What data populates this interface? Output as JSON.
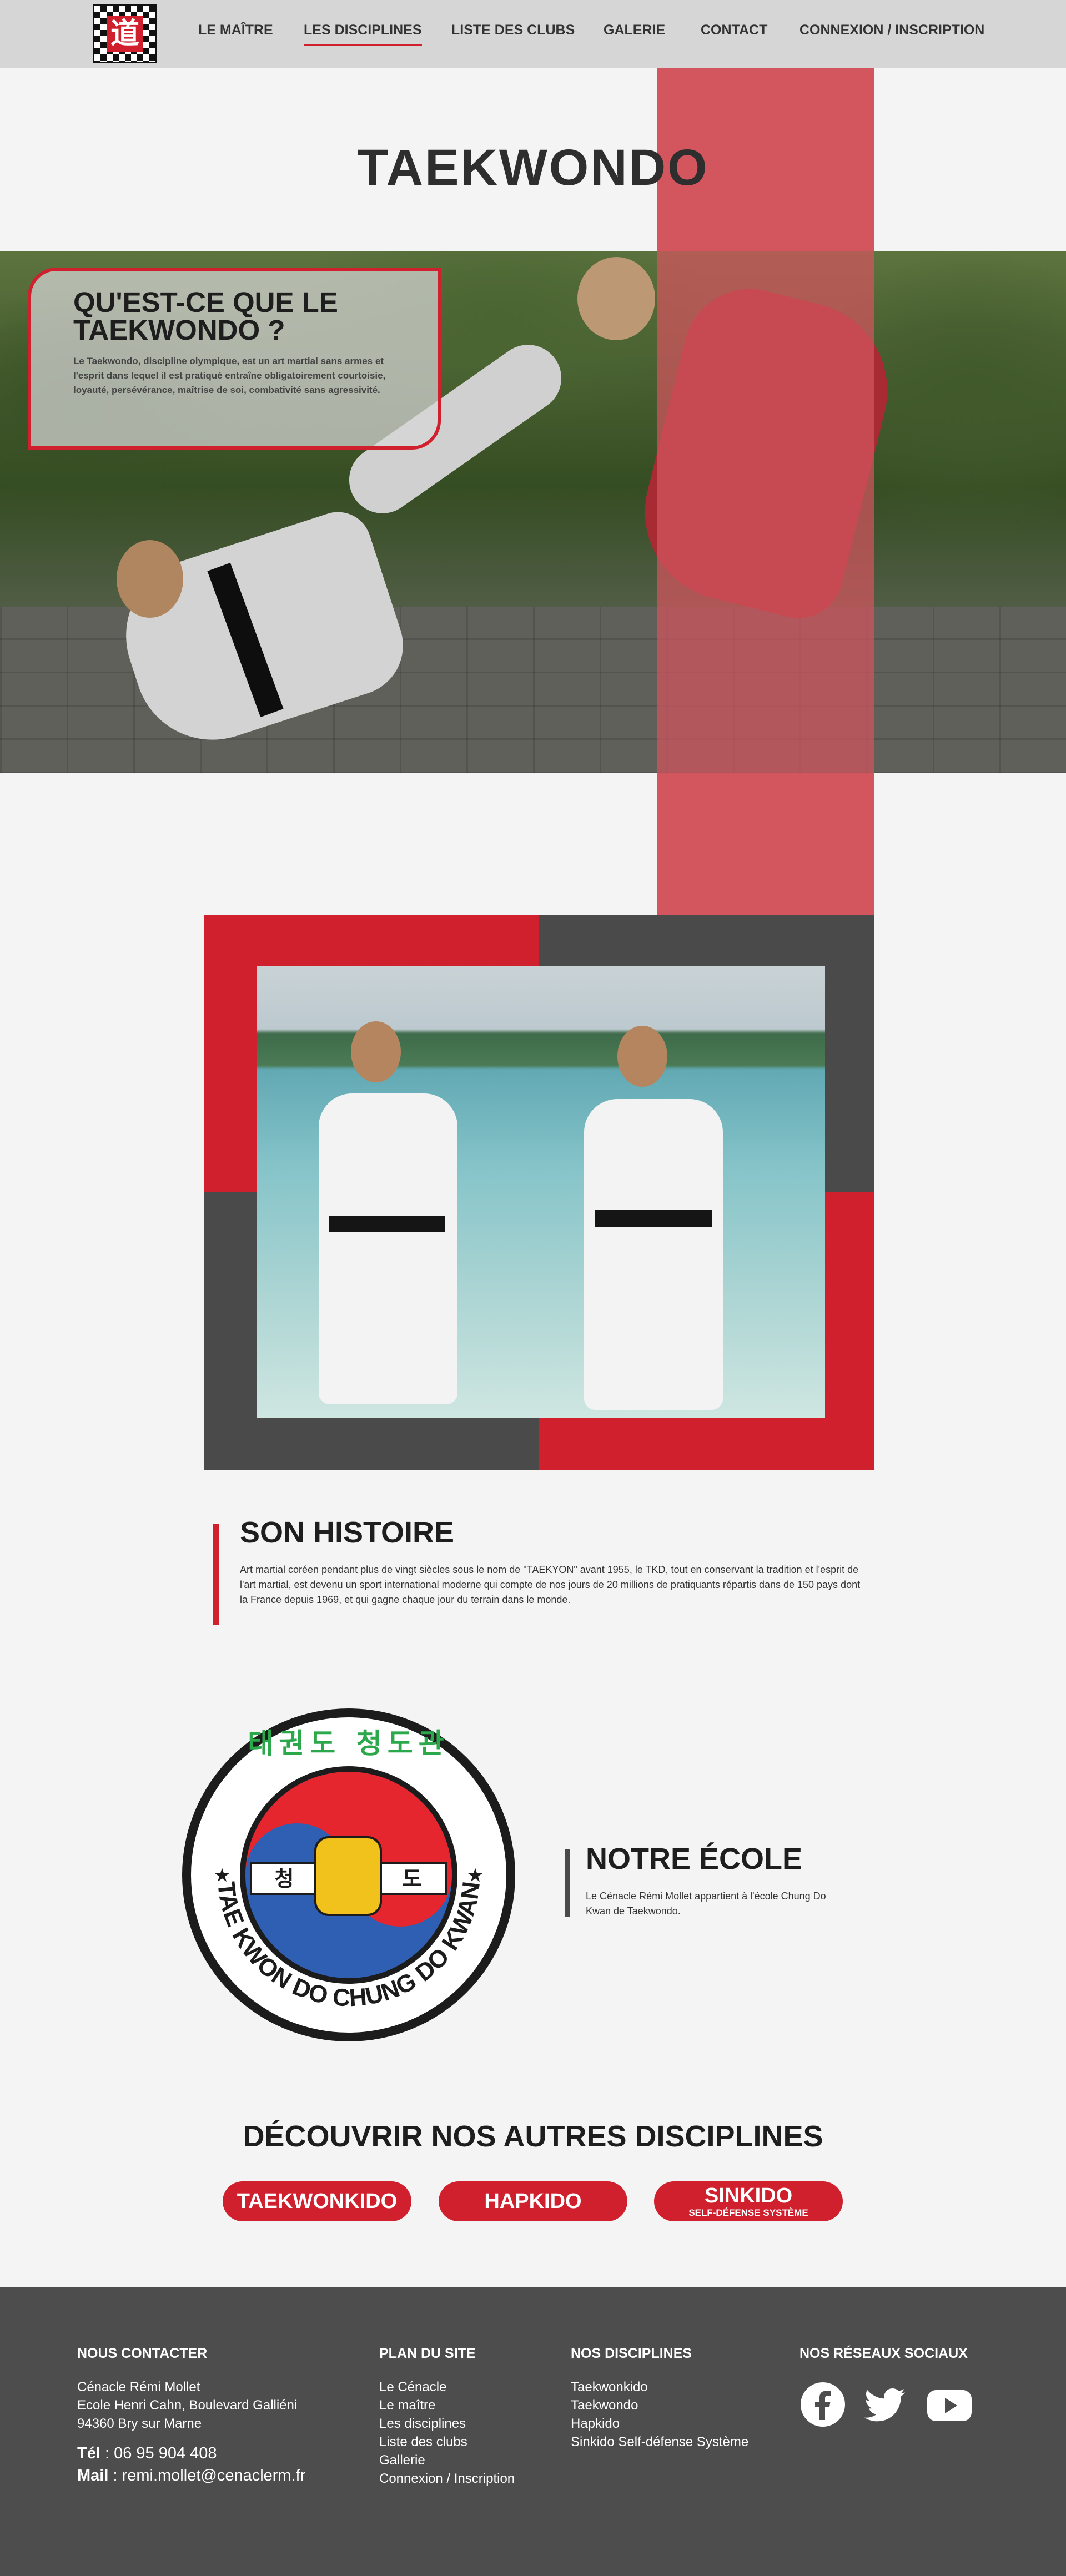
{
  "nav": {
    "items": [
      "LE MAÎTRE",
      "LES DISCIPLINES",
      "LISTE DES CLUBS",
      "GALERIE",
      "CONTACT",
      "CONNEXION / INSCRIPTION"
    ],
    "active_index": 1
  },
  "page": {
    "title": "TAEKWONDO"
  },
  "hero": {
    "box_title": "QU'EST-CE QUE LE TAEKWONDO ?",
    "box_text": "Le Taekwondo, discipline olympique, est un art martial sans armes et l'esprit dans lequel il est pratiqué entraîne obligatoirement courtoisie, loyauté, persévérance, maîtrise de soi, combativité sans agressivité."
  },
  "histoire": {
    "title": "SON HISTOIRE",
    "text": "Art martial coréen pendant plus de vingt siècles sous le nom de \"TAEKYON\" avant 1955, le TKD, tout en conservant la tradition et l'esprit de l'art martial, est devenu un sport international moderne qui compte de nos jours de 20 millions de pratiquants répartis dans de 150 pays dont la France depuis 1969, et qui gagne chaque jour du terrain dans le monde."
  },
  "ecole": {
    "title": "NOTRE ÉCOLE",
    "text": "Le Cénacle Rémi Mollet appartient à l'école Chung Do Kwan de Taekwondo.",
    "emblem_text": "TAE KWON DO CHUNG DO KWAN",
    "emblem_korean_top": "태권도 청도관",
    "emblem_fist_left": "청",
    "emblem_fist_right": "도"
  },
  "disciplines": {
    "title": "DÉCOUVRIR NOS AUTRES DISCIPLINES",
    "buttons": [
      {
        "label": "TAEKWONKIDO",
        "sub": ""
      },
      {
        "label": "HAPKIDO",
        "sub": ""
      },
      {
        "label": "SINKIDO",
        "sub": "SELF-DÉFENSE SYSTÈME"
      }
    ]
  },
  "footer": {
    "contact": {
      "heading": "NOUS CONTACTER",
      "lines": [
        "Cénacle Rémi Mollet",
        "Ecole Henri Cahn, Boulevard Galliéni",
        "94360 Bry sur Marne"
      ],
      "tel_label": "Tél",
      "tel": " : 06 95 904 408",
      "mail_label": "Mail",
      "mail": " : remi.mollet@cenaclerm.fr"
    },
    "plan": {
      "heading": "PLAN DU SITE",
      "links": [
        "Le Cénacle",
        "Le maître",
        "Les disciplines",
        "Liste des clubs",
        "Gallerie",
        "Connexion / Inscription"
      ]
    },
    "disciplines": {
      "heading": "NOS DISCIPLINES",
      "links": [
        "Taekwonkido",
        "Taekwondo",
        "Hapkido",
        "Sinkido Self-défense Système"
      ]
    },
    "social": {
      "heading": "NOS RÉSEAUX SOCIAUX",
      "icons": [
        "facebook-icon",
        "twitter-icon",
        "youtube-icon"
      ]
    }
  },
  "colors": {
    "accent": "#d0202e",
    "accent_soft": "#d3555e",
    "dark": "#4a4a4a",
    "footer": "#4d4d4d",
    "nav": "#d6d6d6"
  }
}
